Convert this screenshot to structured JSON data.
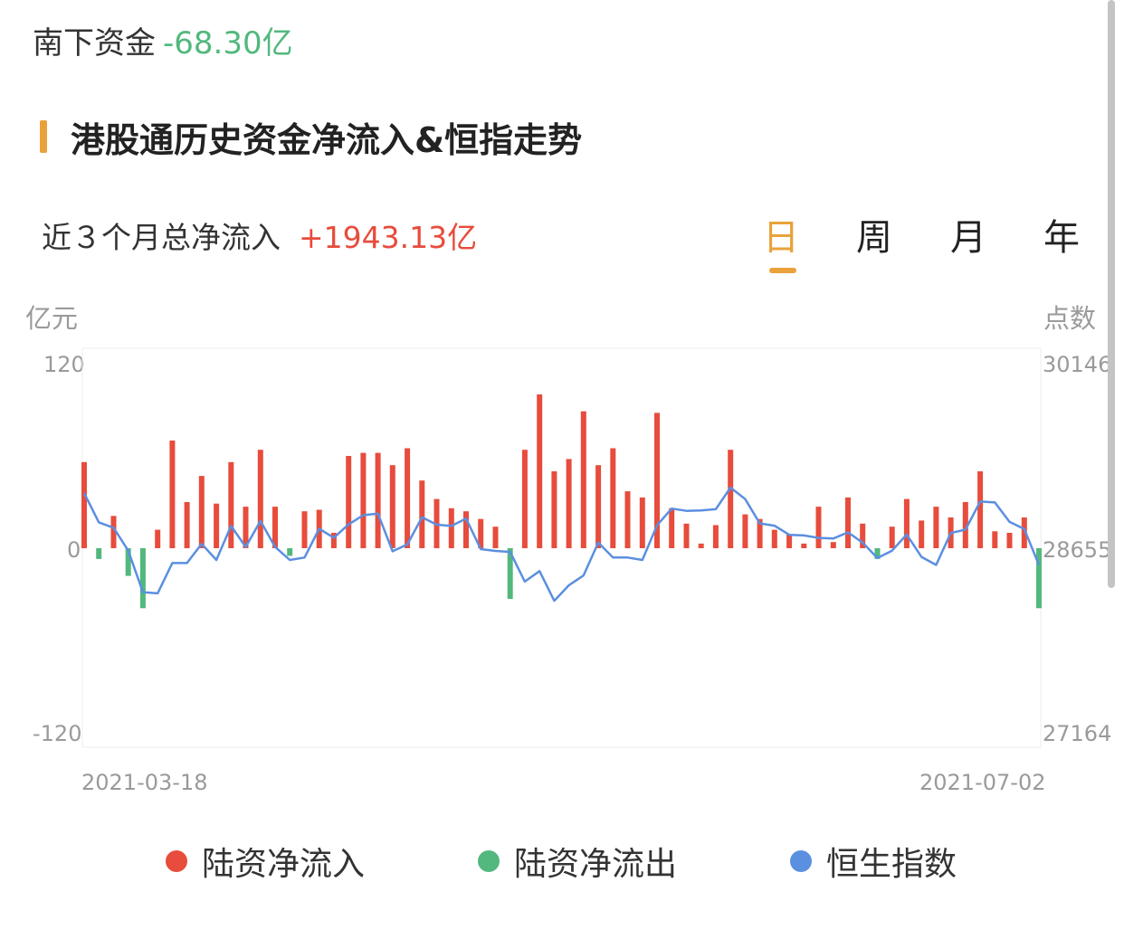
{
  "header": {
    "label": "南下资金",
    "value": "-68.30亿"
  },
  "section": {
    "title": "港股通历史资金净流入&恒指走势"
  },
  "summary": {
    "label": "近３个月总净流入",
    "value": "+1943.13亿"
  },
  "tabs": [
    {
      "label": "日",
      "active": true
    },
    {
      "label": "周",
      "active": false
    },
    {
      "label": "月",
      "active": false
    },
    {
      "label": "年",
      "active": false
    }
  ],
  "axes": {
    "left_unit": "亿元",
    "right_unit": "点数",
    "left_ticks": [
      "120",
      "0",
      "-120"
    ],
    "right_ticks": [
      "30146",
      "28655",
      "27164"
    ],
    "x_start": "2021-03-18",
    "x_end": "2021-07-02"
  },
  "legend": [
    {
      "label": "陆资净流入",
      "color": "#e74c3c"
    },
    {
      "label": "陆资净流出",
      "color": "#52b87d"
    },
    {
      "label": "恒生指数",
      "color": "#5b8fe0"
    }
  ],
  "colors": {
    "inflow": "#e74c3c",
    "outflow": "#52b87d",
    "index": "#5b8fe0",
    "accent": "#e9a23b"
  },
  "chart_data": {
    "type": "bar",
    "x_range": [
      "2021-03-18",
      "2021-07-02"
    ],
    "ylim_left": [
      -120,
      120
    ],
    "ylim_right": [
      27164,
      30146
    ],
    "series": [
      {
        "name": "陆资净流入",
        "values": [
          56,
          -7,
          21,
          -18,
          -39,
          12,
          70,
          30,
          47,
          29,
          56,
          27,
          64,
          27,
          -5,
          24,
          25,
          10,
          60,
          62,
          62,
          54,
          65,
          44,
          32,
          26,
          24,
          19,
          14,
          -33,
          64,
          100,
          50,
          58,
          89,
          54,
          65,
          37,
          33,
          88,
          26,
          16,
          3,
          15,
          64,
          22,
          19,
          12,
          9,
          3,
          27,
          4,
          33,
          16,
          -7,
          14,
          32,
          18,
          27,
          20,
          30,
          50,
          11,
          10,
          20,
          -39
        ]
      },
      {
        "name": "恒生指数",
        "values": [
          29100,
          28864,
          28820,
          28635,
          28300,
          28290,
          28535,
          28535,
          28690,
          28560,
          28835,
          28665,
          28875,
          28665,
          28560,
          28580,
          28812,
          28740,
          28847,
          28922,
          28935,
          28630,
          28685,
          28905,
          28845,
          28835,
          28895,
          28648,
          28633,
          28625,
          28385,
          28470,
          28230,
          28355,
          28435,
          28700,
          28580,
          28580,
          28560,
          28840,
          28975,
          28957,
          28960,
          28970,
          29145,
          29052,
          28855,
          28837,
          28763,
          28758,
          28738,
          28733,
          28783,
          28700,
          28575,
          28635,
          28765,
          28585,
          28520,
          28778,
          28805,
          29032,
          29025,
          28868,
          28810,
          28520
        ]
      }
    ]
  }
}
